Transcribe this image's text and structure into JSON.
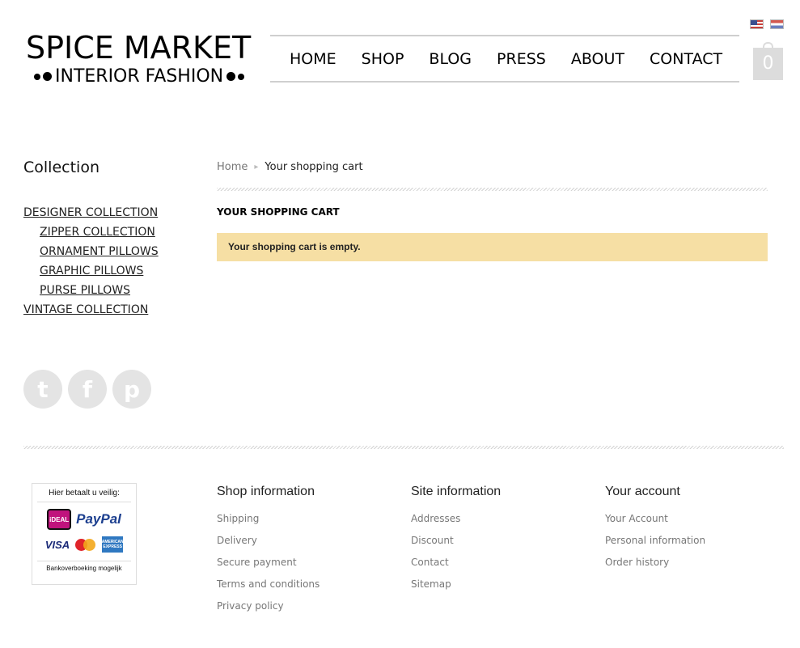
{
  "header": {
    "logo_line1": "SPICE MARKET",
    "logo_line2": "INTERIOR FASHION",
    "nav": [
      "HOME",
      "SHOP",
      "BLOG",
      "PRESS",
      "ABOUT",
      "CONTACT"
    ],
    "cart_count": "0",
    "languages": [
      "English",
      "Nederlands"
    ]
  },
  "sidebar": {
    "title": "Collection",
    "items": [
      {
        "label": "DESIGNER COLLECTION",
        "level": 0
      },
      {
        "label": "ZIPPER COLLECTION",
        "level": 1
      },
      {
        "label": "ORNAMENT PILLOWS",
        "level": 1
      },
      {
        "label": "GRAPHIC PILLOWS",
        "level": 1
      },
      {
        "label": "PURSE PILLOWS",
        "level": 1
      },
      {
        "label": "VINTAGE COLLECTION",
        "level": 0
      }
    ],
    "social": [
      "twitter-icon",
      "facebook-icon",
      "pinterest-icon"
    ]
  },
  "main": {
    "breadcrumb_home": "Home",
    "breadcrumb_current": "Your shopping cart",
    "heading": "YOUR SHOPPING CART",
    "alert": "Your shopping cart is empty."
  },
  "payment": {
    "title": "Hier betaalt u veilig:",
    "ideal": "iDEAL",
    "paypal": "PayPal",
    "visa": "VISA",
    "amex": "AMERICAN EXPRESS",
    "footer": "Bankoverboeking mogelijk"
  },
  "footer": {
    "shop_info": {
      "title": "Shop information",
      "links": [
        "Shipping",
        "Delivery",
        "Secure payment",
        "Terms and conditions",
        "Privacy policy"
      ]
    },
    "site_info": {
      "title": "Site information",
      "links": [
        "Addresses",
        "Discount",
        "Contact",
        "Sitemap"
      ]
    },
    "account": {
      "title": "Your account",
      "links": [
        "Your Account",
        "Personal information",
        "Order history"
      ]
    }
  },
  "colors": {
    "alert_bg": "#f6dfa4",
    "divider": "#cfcfcf"
  }
}
